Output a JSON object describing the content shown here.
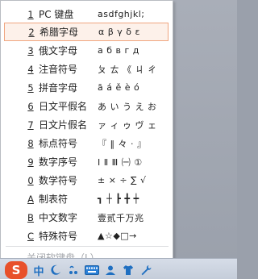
{
  "menu": {
    "items": [
      {
        "key": "1",
        "label": "PC 键盘",
        "sample": "asdfghjkl;"
      },
      {
        "key": "2",
        "label": "希腊字母",
        "sample": "α β γ δ ε"
      },
      {
        "key": "3",
        "label": "俄文字母",
        "sample": "а б в г д"
      },
      {
        "key": "4",
        "label": "注音符号",
        "sample": "ㄆ ㄊ 《 ㄐ ㄔ"
      },
      {
        "key": "5",
        "label": "拼音字母",
        "sample": "ā á ě è ó"
      },
      {
        "key": "6",
        "label": "日文平假名",
        "sample": "あ い う え お"
      },
      {
        "key": "7",
        "label": "日文片假名",
        "sample": "ァ ィ ゥ ヴ ェ"
      },
      {
        "key": "8",
        "label": "标点符号",
        "sample": "『 ‖ 々 · 』"
      },
      {
        "key": "9",
        "label": "数字序号",
        "sample": "Ⅰ Ⅱ Ⅲ ㈠ ①"
      },
      {
        "key": "0",
        "label": "数学符号",
        "sample": "± × ÷ ∑ √"
      },
      {
        "key": "A",
        "label": "制表符",
        "sample": "┓ ┼ ┣ ╋ ┿"
      },
      {
        "key": "B",
        "label": "中文数字",
        "sample": "壹贰千万兆"
      },
      {
        "key": "C",
        "label": "特殊符号",
        "sample": "▲☆◆□→"
      }
    ],
    "selected_index": 1,
    "close_label": "关闭软键盘（L）"
  },
  "ime_toolbar": {
    "logo_text": "S",
    "mode_label": "中",
    "icons": [
      "moon-icon",
      "punctuation-icon",
      "keyboard-icon",
      "user-icon",
      "shirt-icon",
      "wrench-icon"
    ]
  }
}
